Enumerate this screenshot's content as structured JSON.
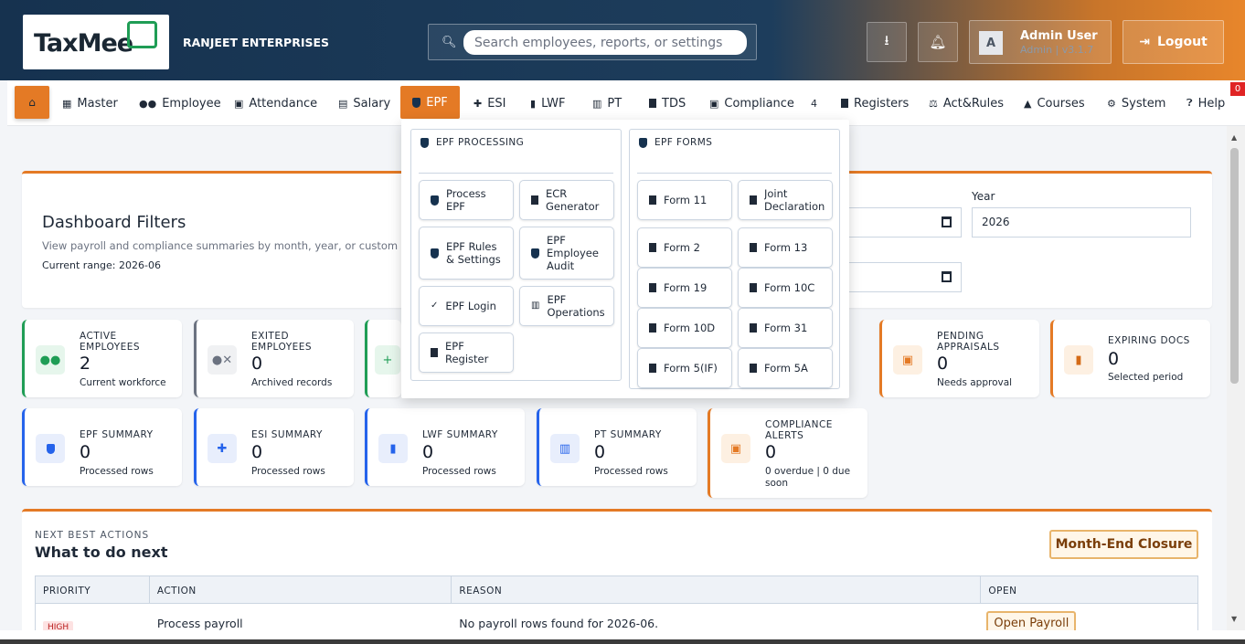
{
  "header": {
    "logo": "TaxMee",
    "company": "RANJEET ENTERPRISES",
    "search_placeholder": "Search employees, reports, or settings",
    "user_initial": "A",
    "user_name": "Admin User",
    "user_role": "Admin | v3.1.7",
    "logout_label": "Logout"
  },
  "nav": {
    "items": [
      {
        "label": "Master",
        "icon": "building-icon"
      },
      {
        "label": "Employee",
        "icon": "users-icon"
      },
      {
        "label": "Attendance",
        "icon": "calendar-icon"
      },
      {
        "label": "Salary",
        "icon": "wallet-icon"
      },
      {
        "label": "EPF",
        "icon": "shield-icon"
      },
      {
        "label": "ESI",
        "icon": "plus-icon"
      },
      {
        "label": "LWF",
        "icon": "bookmark-icon"
      },
      {
        "label": "PT",
        "icon": "briefcase-icon"
      },
      {
        "label": "TDS",
        "icon": "file-icon"
      },
      {
        "label": "Compliance",
        "icon": "calendar-check-icon",
        "badge": "4"
      },
      {
        "label": "Registers",
        "icon": "file-icon"
      },
      {
        "label": "Act&Rules",
        "icon": "scale-icon"
      },
      {
        "label": "Courses",
        "icon": "graduation-cap-icon"
      },
      {
        "label": "System",
        "icon": "gear-icon"
      },
      {
        "label": "Help",
        "icon": "question-icon"
      }
    ],
    "corner_badge": "0"
  },
  "filters": {
    "title": "Dashboard Filters",
    "subtitle": "View payroll and compliance summaries by month, year, or custom date",
    "range": "Current range: 2026-06",
    "year_label": "Year",
    "year_value": "2026"
  },
  "cards": [
    {
      "label": "ACTIVE EMPLOYEES",
      "value": "2",
      "sub": "Current workforce"
    },
    {
      "label": "EXITED EMPLOYEES",
      "value": "0",
      "sub": "Archived records"
    },
    {
      "label": "PENDING APPRAISALS",
      "value": "0",
      "sub": "Needs approval"
    },
    {
      "label": "EXPIRING DOCS",
      "value": "0",
      "sub": "Selected period"
    },
    {
      "label": "EPF SUMMARY",
      "value": "0",
      "sub": "Processed rows"
    },
    {
      "label": "ESI SUMMARY",
      "value": "0",
      "sub": "Processed rows"
    },
    {
      "label": "LWF SUMMARY",
      "value": "0",
      "sub": "Processed rows"
    },
    {
      "label": "PT SUMMARY",
      "value": "0",
      "sub": "Processed rows"
    },
    {
      "label": "COMPLIANCE ALERTS",
      "value": "0",
      "sub": "0 overdue | 0 due soon"
    }
  ],
  "actions": {
    "eyebrow": "NEXT BEST ACTIONS",
    "title": "What to do next",
    "month_end_label": "Month-End Closure",
    "columns": [
      "PRIORITY",
      "ACTION",
      "REASON",
      "OPEN"
    ],
    "rows": [
      {
        "priority": "HIGH",
        "action": "Process payroll",
        "reason": "No payroll rows found for 2026-06.",
        "open": "Open Payroll"
      }
    ]
  },
  "dropdown": {
    "processing_title": "EPF PROCESSING",
    "forms_title": "EPF FORMS",
    "processing": [
      {
        "label": "Process EPF",
        "icon": "shield-icon"
      },
      {
        "label": "ECR Generator",
        "icon": "file-icon"
      },
      {
        "label": "EPF Rules & Settings",
        "icon": "shield-icon"
      },
      {
        "label": "EPF Employee Audit",
        "icon": "shield-icon"
      },
      {
        "label": "EPF Login",
        "icon": "check-icon"
      },
      {
        "label": "EPF Operations",
        "icon": "briefcase-icon"
      },
      {
        "label": "EPF Register",
        "icon": "file-icon"
      }
    ],
    "forms": [
      {
        "label": "Form 11"
      },
      {
        "label": "Joint Declaration"
      },
      {
        "label": "Form 2"
      },
      {
        "label": "Form 13"
      },
      {
        "label": "Form 19"
      },
      {
        "label": "Form 10C"
      },
      {
        "label": "Form 10D"
      },
      {
        "label": "Form 31"
      },
      {
        "label": "Form 5(IF)"
      },
      {
        "label": "Form 5A"
      }
    ]
  },
  "colors": {
    "brand_dark": "#16324f",
    "accent_orange": "#e47a25",
    "green": "#1f9d55",
    "blue": "#2563eb"
  }
}
